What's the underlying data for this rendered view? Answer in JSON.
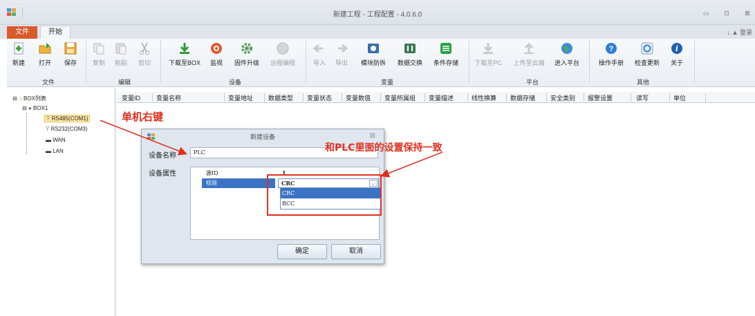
{
  "window": {
    "title": "新建工程 - 工程配置 - 4.0.6.0",
    "controls": [
      "minimize",
      "restore",
      "close"
    ]
  },
  "tabs": {
    "file": "文件",
    "start": "开始",
    "login": "登录"
  },
  "ribbon": {
    "buttons": [
      {
        "label": "新建",
        "icon": "new-icon",
        "enabled": true
      },
      {
        "label": "打开",
        "icon": "open-icon",
        "enabled": true
      },
      {
        "label": "保存",
        "icon": "save-icon",
        "enabled": true
      },
      {
        "label": "复制",
        "icon": "copy-icon",
        "enabled": false
      },
      {
        "label": "粘贴",
        "icon": "paste-icon",
        "enabled": false
      },
      {
        "label": "剪切",
        "icon": "cut-icon",
        "enabled": false
      },
      {
        "label": "下载至BOX",
        "icon": "download-icon",
        "enabled": true
      },
      {
        "label": "监视",
        "icon": "monitor-icon",
        "enabled": true
      },
      {
        "label": "固件升级",
        "icon": "firmware-icon",
        "enabled": true
      },
      {
        "label": "远程编程",
        "icon": "remote-icon",
        "enabled": false
      },
      {
        "label": "导入",
        "icon": "import-icon",
        "enabled": false
      },
      {
        "label": "导出",
        "icon": "export-icon",
        "enabled": false
      },
      {
        "label": "模块防拆",
        "icon": "tamper-icon",
        "enabled": true
      },
      {
        "label": "数据交换",
        "icon": "exchange-icon",
        "enabled": true
      },
      {
        "label": "条件存储",
        "icon": "storage-icon",
        "enabled": true
      },
      {
        "label": "下载至PC",
        "icon": "download-pc-icon",
        "enabled": false
      },
      {
        "label": "上传至云端",
        "icon": "upload-cloud-icon",
        "enabled": false
      },
      {
        "label": "进入平台",
        "icon": "globe-icon",
        "enabled": true
      },
      {
        "label": "操作手册",
        "icon": "help-icon",
        "enabled": true
      },
      {
        "label": "检查更新",
        "icon": "update-icon",
        "enabled": true
      },
      {
        "label": "关于",
        "icon": "info-icon",
        "enabled": true
      }
    ],
    "groups": [
      "文件",
      "编辑",
      "设备",
      "变量",
      "平台",
      "其他"
    ]
  },
  "tree": {
    "root": "BOX列表",
    "box": "BOX1",
    "items": [
      "RS485(COM1)",
      "RS232(COM3)",
      "WAN",
      "LAN"
    ],
    "selected": "RS485(COM1)"
  },
  "grid": {
    "columns": [
      "变量ID",
      "变量名称",
      "变量地址",
      "数据类型",
      "变量状态",
      "变量数值",
      "变量所属组",
      "变量描述",
      "线性换算",
      "数据存储",
      "安全类别",
      "报警设置",
      "读写",
      "单位"
    ]
  },
  "dialog": {
    "title": "新建设备",
    "name_label": "设备名称",
    "name_value": "PLC",
    "props_label": "设备属性",
    "props": [
      {
        "key": "源ID",
        "value": "1"
      },
      {
        "key": "校验",
        "value": "CRC"
      }
    ],
    "dropdown_options": [
      "CRC",
      "BCC"
    ],
    "dropdown_selected": "CRC",
    "ok": "确定",
    "cancel": "取消"
  },
  "annotations": {
    "right_click": "单机右键",
    "keep_consistent": "和PLC里面的设置保持一致"
  },
  "colors": {
    "file_tab": "#d95a2b",
    "annotation": "#e0301e",
    "selection": "#3b73c4"
  }
}
